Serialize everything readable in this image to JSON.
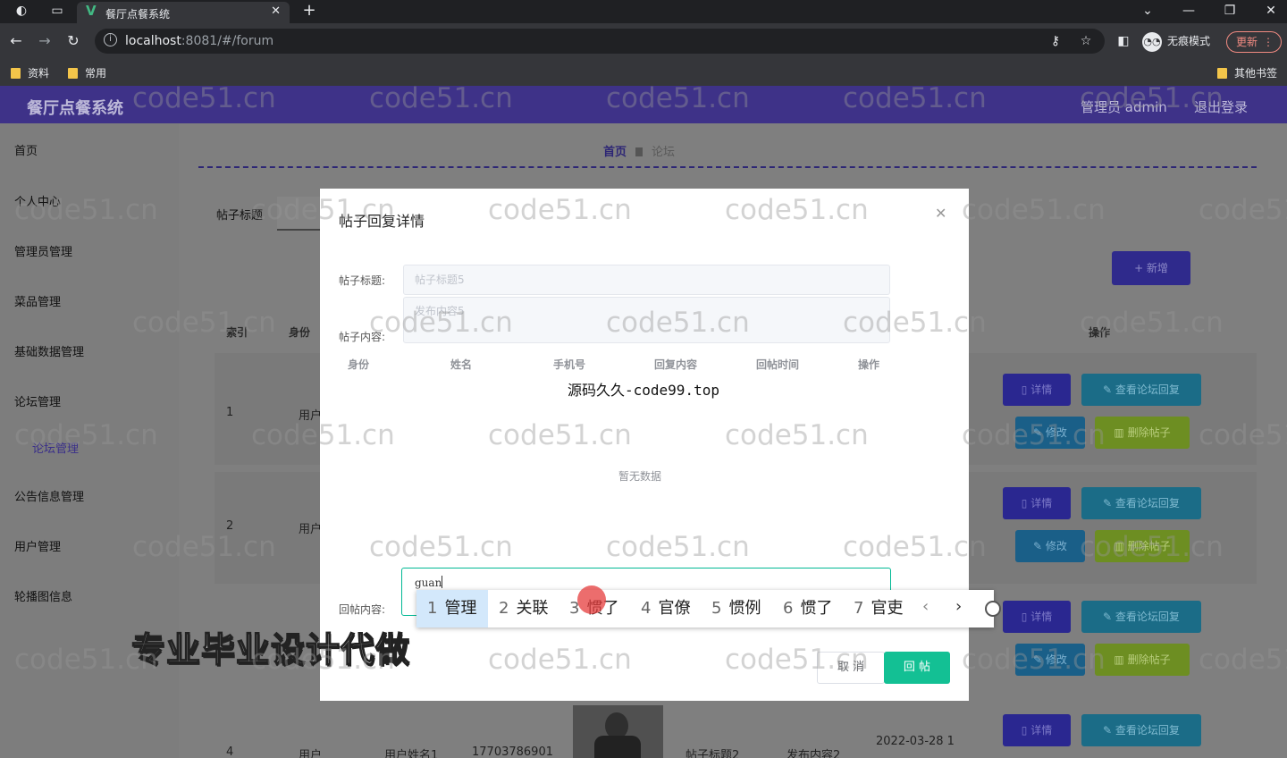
{
  "browser": {
    "tab_title": "餐厅点餐系统",
    "url_host": "localhost",
    "url_path": ":8081/#/forum",
    "incognito_label": "无痕模式",
    "update_label": "更新",
    "bookmarks": [
      "资料",
      "常用"
    ],
    "other_bookmarks": "其他书签"
  },
  "app": {
    "title": "餐厅点餐系统",
    "admin": "管理员 admin",
    "logout": "退出登录"
  },
  "sidebar": {
    "items": [
      "首页",
      "个人中心",
      "管理员管理",
      "菜品管理",
      "基础数据管理",
      "论坛管理",
      "公告信息管理",
      "用户管理",
      "轮播图信息"
    ],
    "sub_item": "论坛管理"
  },
  "main": {
    "breadcrumb_home": "首页",
    "breadcrumb_current": "论坛",
    "search_label": "帖子标题",
    "add_button": "+ 新增",
    "headers": [
      "索引",
      "身份",
      "操作"
    ],
    "rows": [
      {
        "index": "1",
        "identity": "用户"
      },
      {
        "index": "2",
        "identity": "用户"
      },
      {
        "index": "4",
        "identity": "用户",
        "name": "用户姓名1",
        "phone": "17703786901",
        "post_title": "帖子标题2",
        "post_content": "发布内容2",
        "time": "2022-03-28 1"
      }
    ],
    "btn_detail": "详情",
    "btn_view_replies": "查看论坛回复",
    "btn_edit": "修改",
    "btn_delete": "删除帖子"
  },
  "dialog": {
    "title": "帖子回复详情",
    "post_title_label": "帖子标题:",
    "post_title_value": "帖子标题5",
    "post_content_label": "帖子内容:",
    "post_content_value": "发布内容5",
    "table_headers": [
      "身份",
      "姓名",
      "手机号",
      "回复内容",
      "回帖时间",
      "操作"
    ],
    "overlay_text": "源码久久-code99.top",
    "empty_text": "暂无数据",
    "reply_label": "回帖内容:",
    "reply_value": "guan",
    "cancel": "取 消",
    "submit": "回 帖"
  },
  "ime": {
    "candidates": [
      {
        "num": "1",
        "text": "管理"
      },
      {
        "num": "2",
        "text": "关联"
      },
      {
        "num": "3",
        "text": "惯了"
      },
      {
        "num": "4",
        "text": "官僚"
      },
      {
        "num": "5",
        "text": "惯例"
      },
      {
        "num": "6",
        "text": "惯了"
      },
      {
        "num": "7",
        "text": "官吏"
      }
    ]
  },
  "watermark": "code51.cn",
  "promo": "专业毕业设计代做"
}
